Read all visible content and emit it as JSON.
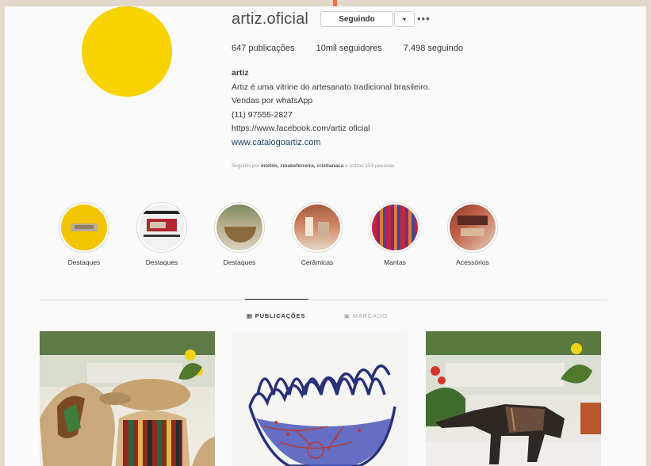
{
  "profile": {
    "username": "artiz.oficial",
    "follow_button_label": "Seguindo",
    "dropdown_label": "▾",
    "more_label": "•••",
    "avatar_color": "#f7d300",
    "stats": {
      "posts": "647 publicações",
      "followers": "10mil seguidores",
      "following": "7.498 seguindo"
    },
    "bio": {
      "name": "artiz",
      "lines": [
        "Artiz é uma vitrine do artesanato tradicional brasileiro.",
        "Vendas por whatsApp",
        "(11) 97555-2827",
        "https://www.facebook.com/artiz oficial"
      ],
      "website": "www.catalogoartiz.com"
    },
    "followed_by": {
      "prefix": "Seguido por",
      "names": "intelim, zmakeferreira, cristianaca",
      "suffix": "e outras 153 pessoas"
    }
  },
  "highlights": [
    {
      "label": "Destaques",
      "icon": "highlight-yellow-thumb"
    },
    {
      "label": "Destaques",
      "icon": "highlight-red-thumb"
    },
    {
      "label": "Destaques",
      "icon": "highlight-bowl-thumb"
    },
    {
      "label": "Cerâmicas",
      "icon": "highlight-ceramics-thumb"
    },
    {
      "label": "Mantas",
      "icon": "highlight-blankets-thumb"
    },
    {
      "label": "Acessórios",
      "icon": "highlight-accessories-thumb"
    }
  ],
  "tabs": {
    "posts_label": "PUBLICAÇÕES",
    "tagged_label": "MARCADO"
  },
  "posts": [
    {
      "icon": "woven-baskets-photo"
    },
    {
      "icon": "blue-wire-basket-photo"
    },
    {
      "icon": "wooden-anteater-photo"
    }
  ],
  "colors": {
    "background": "#fafafa",
    "outer": "#e3d8cc",
    "link": "#1e3f66",
    "accent_top": "#e2773f"
  }
}
